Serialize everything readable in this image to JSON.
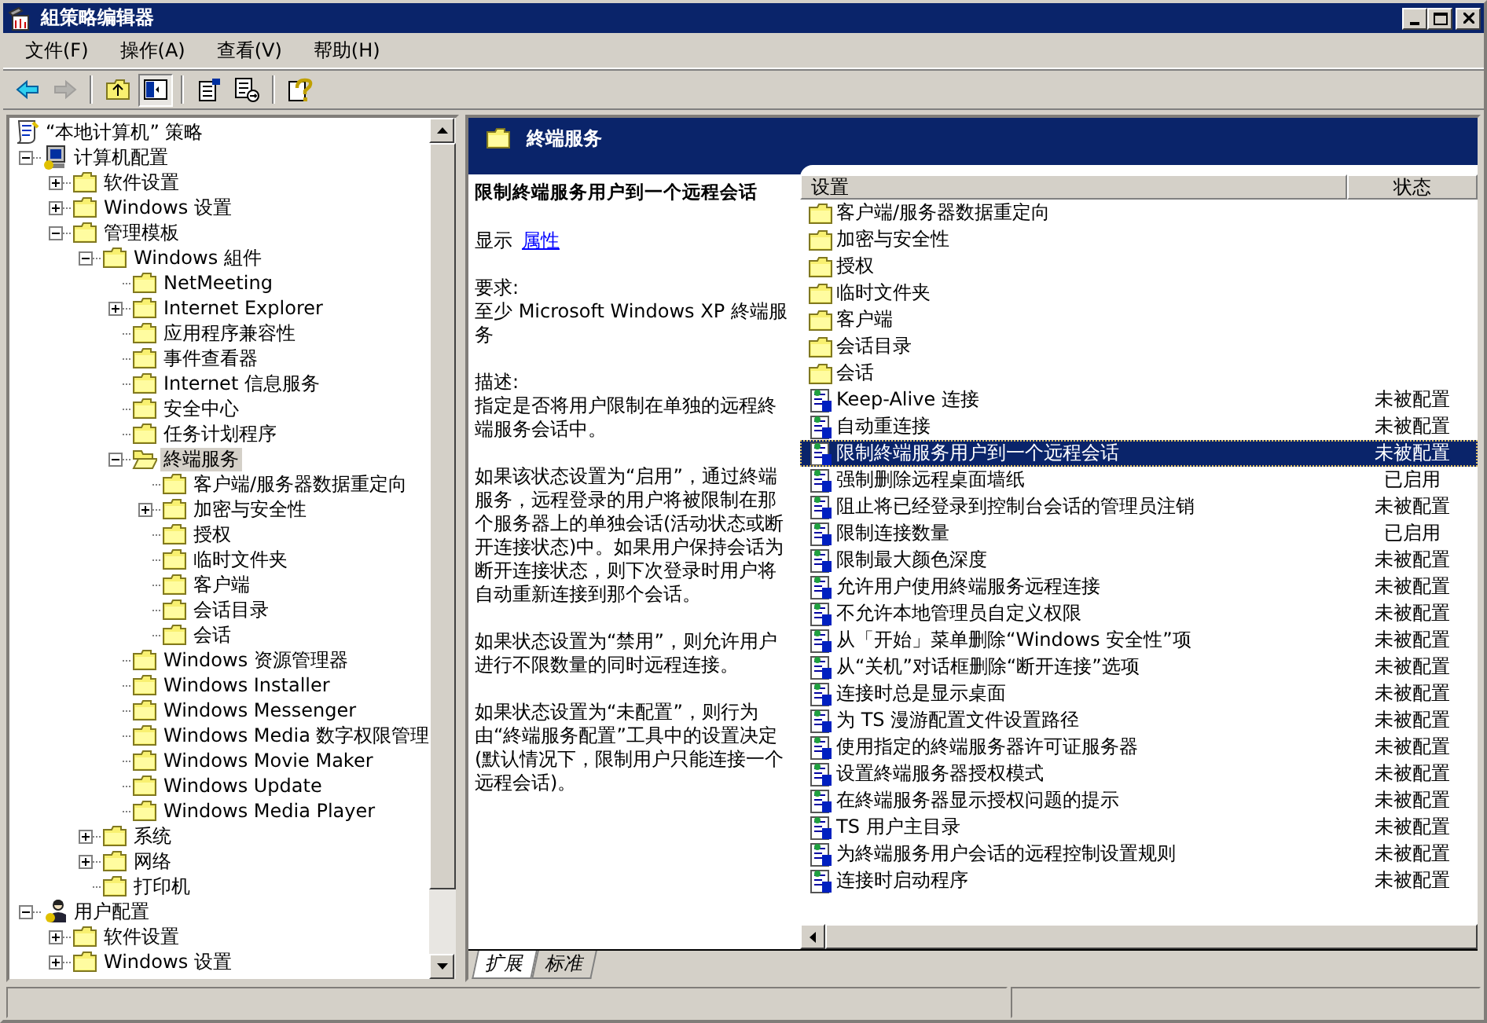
{
  "window": {
    "title": "組策略编辑器"
  },
  "menu": [
    "文件(F)",
    "操作(A)",
    "查看(V)",
    "帮助(H)"
  ],
  "toolbar": [
    {
      "kind": "back",
      "disabled": false,
      "pressed": false
    },
    {
      "kind": "forward",
      "disabled": true,
      "pressed": false
    },
    {
      "kind": "sep"
    },
    {
      "kind": "up",
      "disabled": false,
      "pressed": false
    },
    {
      "kind": "tree",
      "disabled": false,
      "pressed": true
    },
    {
      "kind": "sep"
    },
    {
      "kind": "properties",
      "disabled": false,
      "pressed": false
    },
    {
      "kind": "export",
      "disabled": false,
      "pressed": false
    },
    {
      "kind": "sep"
    },
    {
      "kind": "help",
      "disabled": false,
      "pressed": false
    }
  ],
  "tree": [
    {
      "label": "“本地计算机” 策略",
      "kind": "policy",
      "selected": false,
      "children": [
        {
          "label": "计算机配置",
          "kind": "computer",
          "expanded": true,
          "selected": false,
          "children": [
            {
              "label": "软件设置",
              "kind": "folder",
              "expanded": false,
              "selected": false
            },
            {
              "label": "Windows 设置",
              "kind": "folder",
              "expanded": false,
              "selected": false
            },
            {
              "label": "管理模板",
              "kind": "folder",
              "expanded": true,
              "selected": false,
              "children": [
                {
                  "label": "Windows 組件",
                  "kind": "folder",
                  "expanded": true,
                  "selected": false,
                  "children": [
                    {
                      "label": "NetMeeting",
                      "kind": "folder",
                      "selected": false
                    },
                    {
                      "label": "Internet Explorer",
                      "kind": "folder",
                      "expanded": false,
                      "selected": false
                    },
                    {
                      "label": "应用程序兼容性",
                      "kind": "folder",
                      "selected": false
                    },
                    {
                      "label": "事件查看器",
                      "kind": "folder",
                      "selected": false
                    },
                    {
                      "label": "Internet 信息服务",
                      "kind": "folder",
                      "selected": false
                    },
                    {
                      "label": "安全中心",
                      "kind": "folder",
                      "selected": false
                    },
                    {
                      "label": "任务计划程序",
                      "kind": "folder",
                      "selected": false
                    },
                    {
                      "label": "終端服务",
                      "kind": "openfolder",
                      "expanded": true,
                      "selected": true,
                      "children": [
                        {
                          "label": "客户端/服务器数据重定向",
                          "kind": "folder",
                          "selected": false
                        },
                        {
                          "label": "加密与安全性",
                          "kind": "folder",
                          "expanded": false,
                          "selected": false
                        },
                        {
                          "label": "授权",
                          "kind": "folder",
                          "selected": false
                        },
                        {
                          "label": "临时文件夹",
                          "kind": "folder",
                          "selected": false
                        },
                        {
                          "label": "客户端",
                          "kind": "folder",
                          "selected": false
                        },
                        {
                          "label": "会话目录",
                          "kind": "folder",
                          "selected": false
                        },
                        {
                          "label": "会话",
                          "kind": "folder",
                          "selected": false
                        }
                      ]
                    },
                    {
                      "label": "Windows 资源管理器",
                      "kind": "folder",
                      "selected": false
                    },
                    {
                      "label": "Windows Installer",
                      "kind": "folder",
                      "selected": false
                    },
                    {
                      "label": "Windows Messenger",
                      "kind": "folder",
                      "selected": false
                    },
                    {
                      "label": "Windows Media 数字权限管理",
                      "kind": "folder",
                      "selected": false
                    },
                    {
                      "label": "Windows Movie Maker",
                      "kind": "folder",
                      "selected": false
                    },
                    {
                      "label": "Windows Update",
                      "kind": "folder",
                      "selected": false
                    },
                    {
                      "label": "Windows Media Player",
                      "kind": "folder",
                      "selected": false
                    }
                  ]
                },
                {
                  "label": "系统",
                  "kind": "folder",
                  "expanded": false,
                  "selected": false
                },
                {
                  "label": "网络",
                  "kind": "folder",
                  "expanded": false,
                  "selected": false
                },
                {
                  "label": "打印机",
                  "kind": "folder",
                  "selected": false
                }
              ]
            }
          ]
        },
        {
          "label": "用户配置",
          "kind": "user",
          "expanded": true,
          "selected": false,
          "children": [
            {
              "label": "软件设置",
              "kind": "folder",
              "expanded": false,
              "selected": false
            },
            {
              "label": "Windows 设置",
              "kind": "folder",
              "expanded": false,
              "selected": false
            }
          ]
        }
      ]
    }
  ],
  "header": {
    "title": "終端服务"
  },
  "details": {
    "title": "限制終端服务用户到一个远程会话",
    "show_label": "显示",
    "show_link": "属性",
    "requirements_label": "要求:",
    "requirements": "至少 Microsoft Windows XP 終端服务",
    "description_label": "描述:",
    "description": "指定是否将用户限制在单独的远程終端服务会话中。",
    "paragraphs": [
      "如果该状态设置为“启用”，通过終端服务，远程登录的用户将被限制在那个服务器上的单独会话(活动状态或断开连接状态)中。如果用户保持会话为断开连接状态，则下次登录时用户将自动重新连接到那个会话。",
      "如果状态设置为“禁用”，则允许用户进行不限数量的同时远程连接。",
      "如果状态设置为“未配置”，则行为由“終端服务配置”工具中的设置决定(默认情况下，限制用户只能连接一个远程会话)。"
    ]
  },
  "table": {
    "columns": [
      "设置",
      "状态"
    ],
    "rows": [
      {
        "kind": "folder",
        "name": "客户端/服务器数据重定向",
        "selected": false
      },
      {
        "kind": "folder",
        "name": "加密与安全性",
        "selected": false
      },
      {
        "kind": "folder",
        "name": "授权",
        "selected": false
      },
      {
        "kind": "folder",
        "name": "临时文件夹",
        "selected": false
      },
      {
        "kind": "folder",
        "name": "客户端",
        "selected": false
      },
      {
        "kind": "folder",
        "name": "会话目录",
        "selected": false
      },
      {
        "kind": "folder",
        "name": "会话",
        "selected": false
      },
      {
        "kind": "setting",
        "name": "Keep-Alive 连接",
        "state": "未被配置",
        "selected": false
      },
      {
        "kind": "setting",
        "name": "自动重连接",
        "state": "未被配置",
        "selected": false
      },
      {
        "kind": "setting",
        "name": "限制終端服务用户到一个远程会话",
        "state": "未被配置",
        "selected": true
      },
      {
        "kind": "setting",
        "name": "强制删除远程桌面墙纸",
        "state": "已启用",
        "selected": false
      },
      {
        "kind": "setting",
        "name": "阻止将已经登录到控制台会话的管理员注销",
        "state": "未被配置",
        "selected": false
      },
      {
        "kind": "setting",
        "name": "限制连接数量",
        "state": "已启用",
        "selected": false
      },
      {
        "kind": "setting",
        "name": "限制最大颜色深度",
        "state": "未被配置",
        "selected": false
      },
      {
        "kind": "setting",
        "name": "允许用户使用終端服务远程连接",
        "state": "未被配置",
        "selected": false
      },
      {
        "kind": "setting",
        "name": "不允许本地管理员自定义权限",
        "state": "未被配置",
        "selected": false
      },
      {
        "kind": "setting",
        "name": "从「开始」菜单删除“Windows 安全性”项",
        "state": "未被配置",
        "selected": false
      },
      {
        "kind": "setting",
        "name": "从“关机”对话框删除“断开连接”选项",
        "state": "未被配置",
        "selected": false
      },
      {
        "kind": "setting",
        "name": "连接时总是显示桌面",
        "state": "未被配置",
        "selected": false
      },
      {
        "kind": "setting",
        "name": "为 TS 漫游配置文件设置路径",
        "state": "未被配置",
        "selected": false
      },
      {
        "kind": "setting",
        "name": "使用指定的終端服务器许可证服务器",
        "state": "未被配置",
        "selected": false
      },
      {
        "kind": "setting",
        "name": "设置終端服务器授权模式",
        "state": "未被配置",
        "selected": false
      },
      {
        "kind": "setting",
        "name": "在終端服务器显示授权问题的提示",
        "state": "未被配置",
        "selected": false
      },
      {
        "kind": "setting",
        "name": "TS 用户主目录",
        "state": "未被配置",
        "selected": false
      },
      {
        "kind": "setting",
        "name": "为終端服务用户会话的远程控制设置规则",
        "state": "未被配置",
        "selected": false
      },
      {
        "kind": "setting",
        "name": "连接时启动程序",
        "state": "未被配置",
        "selected": false
      }
    ]
  },
  "tabs": [
    {
      "label": "扩展",
      "selected": true
    },
    {
      "label": "标准",
      "selected": false
    }
  ]
}
